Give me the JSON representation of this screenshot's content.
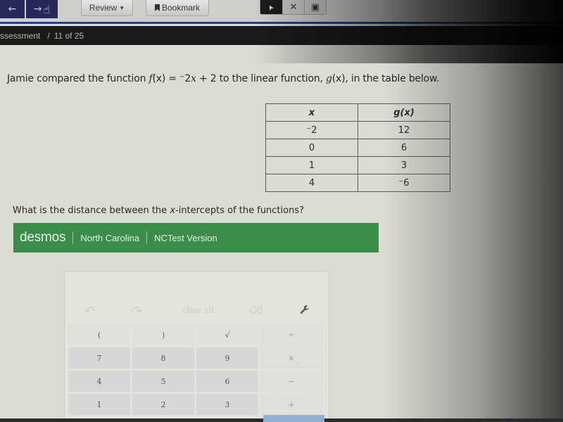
{
  "toolbar": {
    "back_icon": "arrow-left-icon",
    "forward_icon": "arrow-right-icon",
    "cursor_hand_icon": "pointer-hand-icon",
    "review_label": "Review",
    "bookmark_label": "Bookmark",
    "tools": [
      {
        "name": "pointer-tool",
        "icon": "cursor-arrow-icon",
        "glyph": "➤",
        "active": true
      },
      {
        "name": "eliminate-tool",
        "icon": "close-icon",
        "glyph": "✕",
        "active": false
      },
      {
        "name": "notepad-tool",
        "icon": "notepad-icon",
        "glyph": "▣",
        "active": false
      }
    ],
    "back_glyph": "←",
    "forward_glyph": "→",
    "hand_glyph": "☝",
    "caret_glyph": "▼"
  },
  "breadcrumb": {
    "assessment": "ssessment",
    "separator": "/",
    "position": "11 of 25"
  },
  "prompt": {
    "before": "Jamie compared the function ",
    "f_expr": "f",
    "f_arg": "(x)",
    "equals": " = ",
    "rhs_coef": "⁻2",
    "rhs_var": "x",
    "rhs_rest": " + 2 to the linear function, ",
    "g_expr": "g",
    "g_arg": "(x)",
    "after": ", in the table below."
  },
  "table": {
    "headers": [
      "x",
      "g(x)"
    ],
    "rows": [
      [
        "⁻2",
        "12"
      ],
      [
        "0",
        "6"
      ],
      [
        "1",
        "3"
      ],
      [
        "4",
        "⁻6"
      ]
    ]
  },
  "question": {
    "before": "What is the distance between the ",
    "var": "x",
    "after": "-intercepts of the functions?"
  },
  "desmos": {
    "logo": "desmos",
    "region": "North Carolina",
    "version": "NCTest Version",
    "brand_color": "#3b8c48"
  },
  "calculator": {
    "top_row": {
      "undo": "↶",
      "redo": "↷",
      "clear_all": "clear all",
      "backspace": "⌫",
      "settings": "🔧"
    },
    "keys": [
      [
        "(",
        ")",
        "√",
        "÷"
      ],
      [
        "7",
        "8",
        "9",
        "×"
      ],
      [
        "4",
        "5",
        "6",
        "−"
      ],
      [
        "1",
        "2",
        "3",
        "+"
      ]
    ]
  }
}
